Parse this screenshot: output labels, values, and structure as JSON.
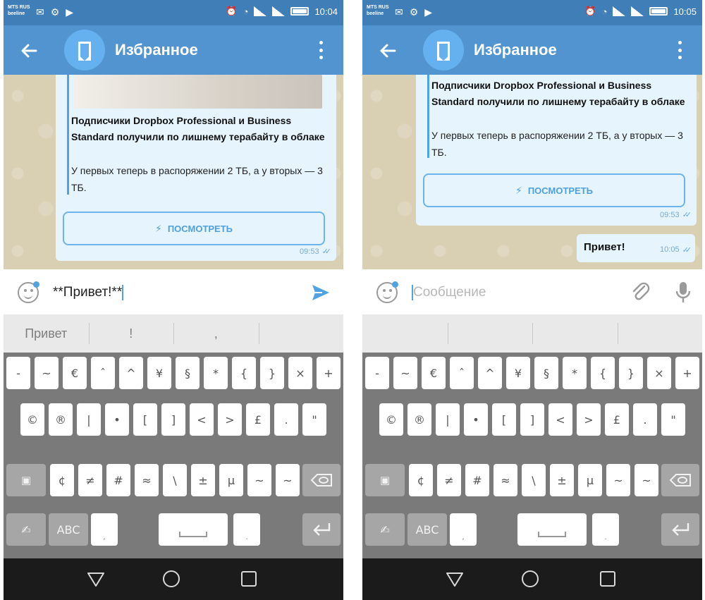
{
  "left": {
    "status": {
      "carrier": "MTS RUS\nbeeline",
      "time": "10:04"
    },
    "chat_title": "Избранное",
    "link_preview": {
      "title": "Подписчики Dropbox Professional и Business Standard получили по лишнему терабайту в облаке",
      "description": "У первых теперь в распоряжении 2 ТБ, а у вторых — 3 ТБ.",
      "button": "ПОСМОТРЕТЬ",
      "time": "09:53"
    },
    "input": {
      "value": "**Привет!**"
    },
    "suggestions": [
      "Привет",
      "!",
      ","
    ]
  },
  "right": {
    "status": {
      "carrier": "MTS RUS\nbeeline",
      "time": "10:05"
    },
    "chat_title": "Избранное",
    "link_preview": {
      "title": "Подписчики Dropbox Professional и Business Standard получили по лишнему терабайту в облаке",
      "description": "У первых теперь в распоряжении 2 ТБ, а у вторых — 3 ТБ.",
      "button": "ПОСМОТРЕТЬ",
      "time": "09:53"
    },
    "sent_message": {
      "text": "Привет!",
      "time": "10:05"
    },
    "input": {
      "placeholder": "Сообщение"
    }
  },
  "keyboard": {
    "row1": [
      "-",
      "~",
      "€",
      "ˆ",
      "^",
      "¥",
      "§",
      "*",
      "{",
      "}",
      "×",
      "+"
    ],
    "row2": [
      "©",
      "®",
      "|",
      "•",
      "[",
      "]",
      "<",
      ">",
      "£",
      ".",
      "\""
    ],
    "row3": [
      "¢",
      "≠",
      "#",
      "≈",
      "\\",
      "±",
      "µ",
      "~",
      "~"
    ],
    "row4_abc": "ABC",
    "row4_comma": ",",
    "row4_period": "."
  },
  "colors": {
    "status_bar": "#3f7eb6",
    "app_bar": "#5294cf",
    "accent": "#4fa3e0",
    "bubble": "#e6f4fd",
    "chat_bg": "#d9cfb3"
  }
}
